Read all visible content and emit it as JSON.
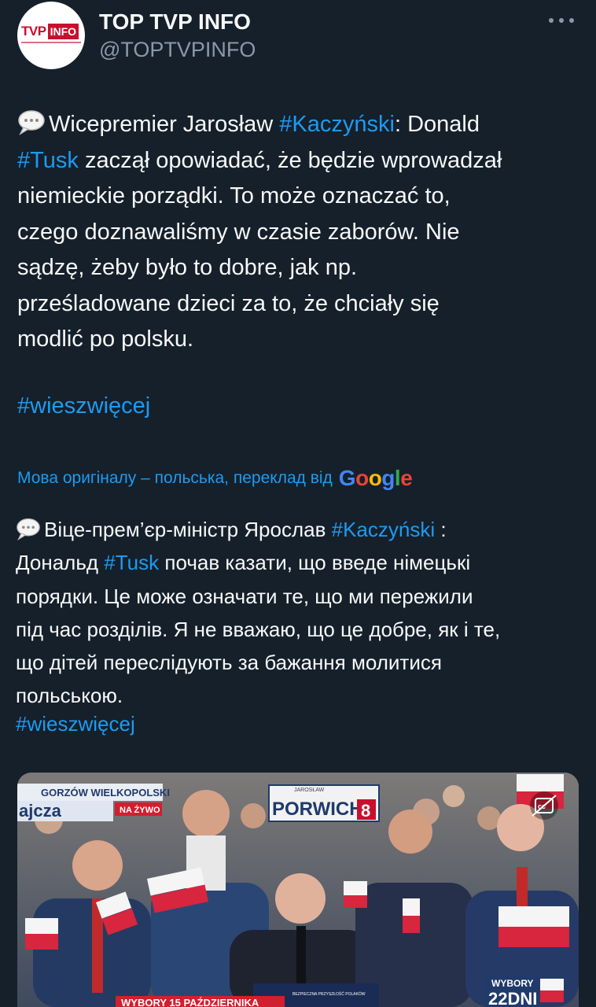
{
  "account": {
    "name": "TOP TVP INFO",
    "handle": "@TOPTVPINFO",
    "avatar_logo": {
      "tvp": "TVP",
      "info": "INFO"
    }
  },
  "tweet": {
    "icon": "speech-bubble-icon",
    "lines": [
      [
        {
          "t": "Wicepremier Jarosław "
        },
        {
          "t": "#Kaczyński",
          "tag": true
        },
        {
          "t": ": Donald"
        }
      ],
      [
        {
          "t": "#Tusk",
          "tag": true
        },
        {
          "t": " zaczął opowiadać, że będzie wprowadzał"
        }
      ],
      [
        {
          "t": "niemieckie porządki. To może oznaczać to,"
        }
      ],
      [
        {
          "t": "czego doznawaliśmy w czasie zaborów. Nie"
        }
      ],
      [
        {
          "t": "sądzę, żeby było to dobre, jak np."
        }
      ],
      [
        {
          "t": "prześladowane dzieci za to, że chciały się"
        }
      ],
      [
        {
          "t": "modlić po polsku."
        }
      ]
    ],
    "hashtag": "#wieszwięcej"
  },
  "translation": {
    "notice": "Мова оригіналу – польська, переклад від",
    "provider": "Google",
    "provider_letters": [
      {
        "c": "G",
        "color": "#4285F4"
      },
      {
        "c": "o",
        "color": "#EA4335"
      },
      {
        "c": "o",
        "color": "#FBBC05"
      },
      {
        "c": "g",
        "color": "#4285F4"
      },
      {
        "c": "l",
        "color": "#34A853"
      },
      {
        "c": "e",
        "color": "#EA4335"
      }
    ],
    "lines": [
      [
        {
          "t": "Віце-прем’єр-міністр Ярослав "
        },
        {
          "t": "#Kaczyński",
          "tag": true
        },
        {
          "t": " :"
        }
      ],
      [
        {
          "t": "Дональд "
        },
        {
          "t": "#Tusk",
          "tag": true
        },
        {
          "t": " почав казати, що введе німецькі"
        }
      ],
      [
        {
          "t": "порядки. Це може означати те, що ми пережили"
        }
      ],
      [
        {
          "t": "під час розділів. Я не вважаю, що це добре, як і те,"
        }
      ],
      [
        {
          "t": "що дітей переслідують за бажання молитися"
        }
      ],
      [
        {
          "t": "польською."
        }
      ]
    ],
    "hashtag": "#wieszwięcej"
  },
  "media": {
    "location_banner": "GORZÓW WIELKOPOLSKI",
    "name_fragment": "ajcza",
    "live_badge": "NA ŻYWO",
    "sign_small": "JAROSŁAW",
    "sign_text": "PORWICH",
    "sign_number": "8",
    "bottom_ticker": "WYBORY 15 PAŹDZIERNIKA",
    "podium_text": "BEZPIECZNA PRZYSZŁOŚĆ POLAKÓW",
    "countdown_label": "WYBORY",
    "countdown_value": "22DNI",
    "cc_icon": "closed-captions-icon"
  },
  "colors": {
    "background": "#15202b",
    "link": "#1d9bf0",
    "text": "#f7f9f9",
    "secondary": "#8b98a5",
    "tvp_red": "#c8102e"
  }
}
